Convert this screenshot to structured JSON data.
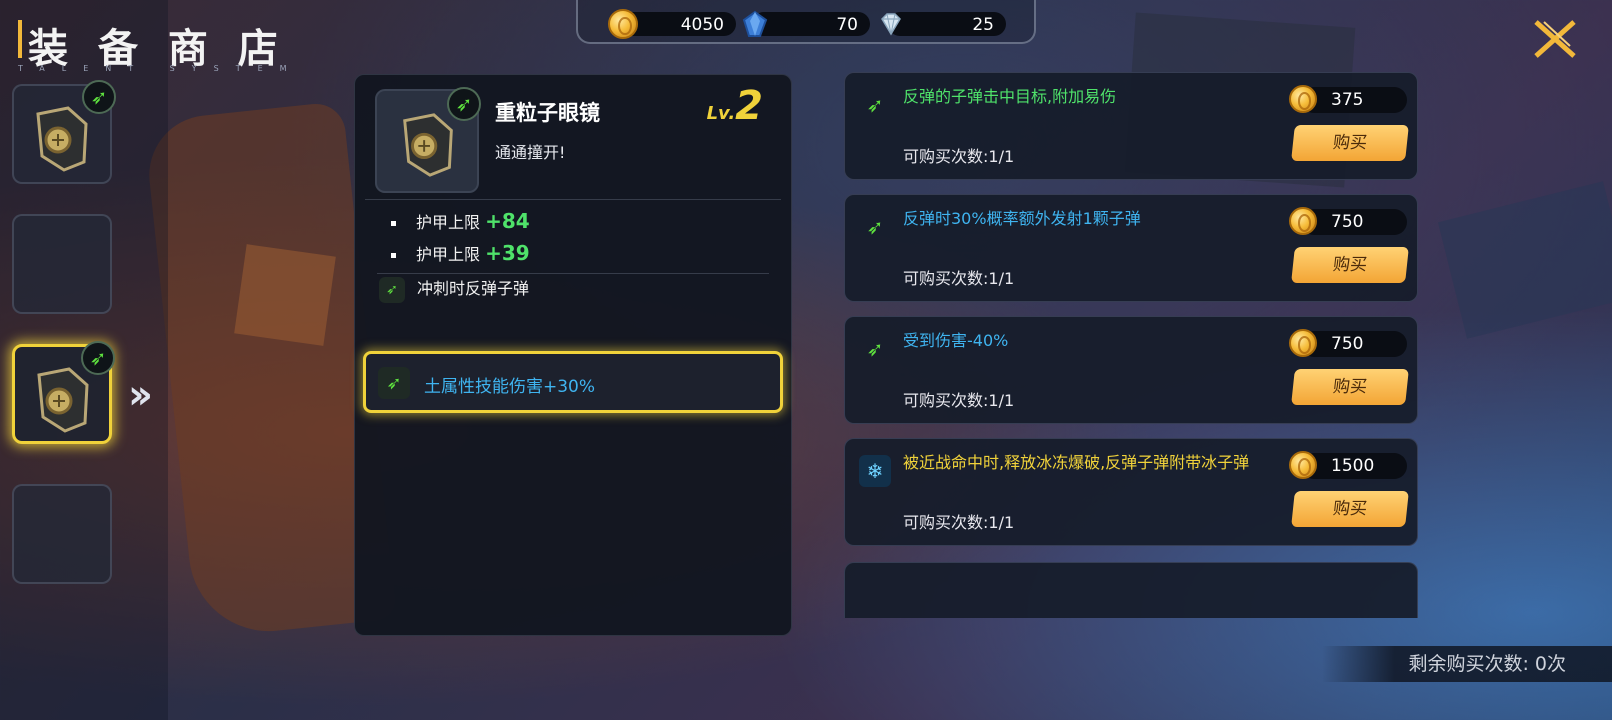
{
  "header": {
    "title": "装 备 商 店",
    "subtitle": "TALENT SYSTEM"
  },
  "currency": {
    "gold": "4050",
    "gems": "70",
    "diamonds": "25"
  },
  "selected_item": {
    "name": "重粒子眼镜",
    "description": "通通撞开!",
    "level_prefix": "Lv.",
    "level": "2",
    "stats": [
      {
        "label": "护甲上限",
        "value": "+84"
      },
      {
        "label": "护甲上限",
        "value": "+39"
      }
    ],
    "effect": "冲刺时反弹子弹",
    "highlight": "土属性技能伤害+30%"
  },
  "shop": {
    "items": [
      {
        "title": "反弹的子弹击中目标,附加易伤",
        "title_color": "#4fe26a",
        "price": "375",
        "count": "可购买次数:1/1",
        "buy_label": "购买",
        "icon": "dash-arrow-icon"
      },
      {
        "title": "反弹时30%概率额外发射1颗子弹",
        "title_color": "#3fb4f0",
        "price": "750",
        "count": "可购买次数:1/1",
        "buy_label": "购买",
        "icon": "dash-arrow-icon"
      },
      {
        "title": "受到伤害-40%",
        "title_color": "#3fb4f0",
        "price": "750",
        "count": "可购买次数:1/1",
        "buy_label": "购买",
        "icon": "dash-arrow-icon"
      },
      {
        "title": "被近战命中时,释放冰冻爆破,反弹子弹附带冰子弹",
        "title_color": "#f0d23a",
        "price": "1500",
        "count": "可购买次数:1/1",
        "buy_label": "购买",
        "icon": "snowflake-icon"
      }
    ],
    "remaining": "剩余购买次数: 0次"
  },
  "colors": {
    "accent": "#f0d23a",
    "green": "#4fe26a",
    "blue": "#3fb4f0",
    "button": "#f3a535"
  }
}
